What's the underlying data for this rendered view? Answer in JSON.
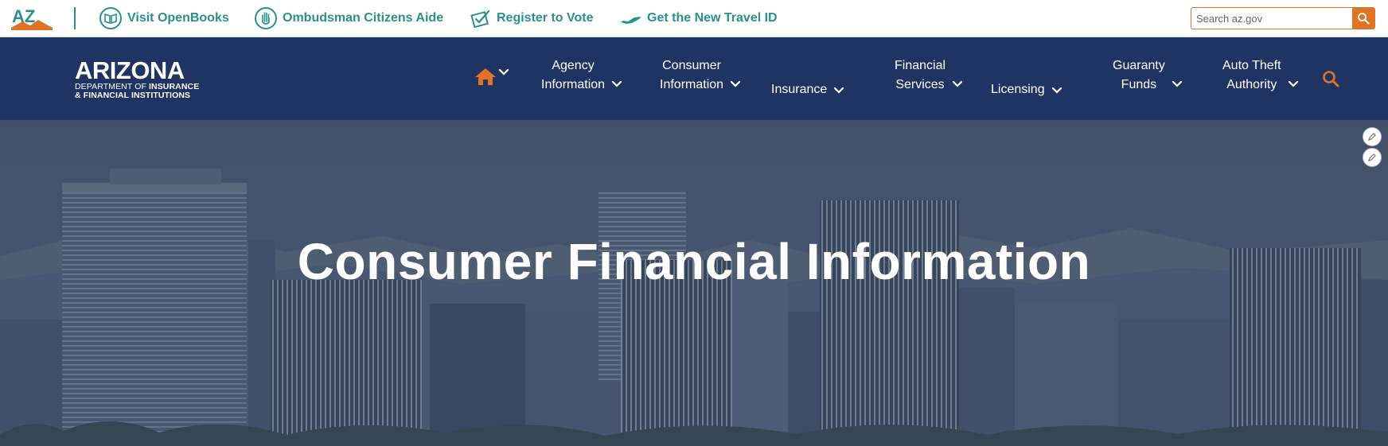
{
  "top_bar": {
    "logo_text": "AZ",
    "links": [
      {
        "label": "Visit OpenBooks",
        "icon": "open-book-icon"
      },
      {
        "label": "Ombudsman Citizens Aide",
        "icon": "hand-icon"
      },
      {
        "label": "Register to Vote",
        "icon": "ballot-check-icon"
      },
      {
        "label": "Get the New Travel ID",
        "icon": "airplane-icon"
      }
    ],
    "search": {
      "placeholder": "Search az.gov",
      "value": ""
    }
  },
  "nav": {
    "brand": {
      "title": "ARIZONA",
      "line1_prefix": "DEPARTMENT OF ",
      "line1_bold": "INSURANCE",
      "line2": "& FINANCIAL INSTITUTIONS"
    },
    "items": [
      {
        "line1": "Agency",
        "line2": "Information"
      },
      {
        "line1": "Consumer",
        "line2": "Information"
      },
      {
        "line1": "",
        "line2": "Insurance"
      },
      {
        "line1": "Financial",
        "line2": "Services"
      },
      {
        "line1": "",
        "line2": "Licensing"
      },
      {
        "line1": "Guaranty",
        "line2": "Funds"
      },
      {
        "line1": "Auto Theft",
        "line2": "Authority"
      }
    ]
  },
  "hero": {
    "title": "Consumer Financial Information"
  },
  "colors": {
    "accent_orange": "#e17327",
    "teal": "#2b8f8a",
    "navy": "#1f3462"
  }
}
